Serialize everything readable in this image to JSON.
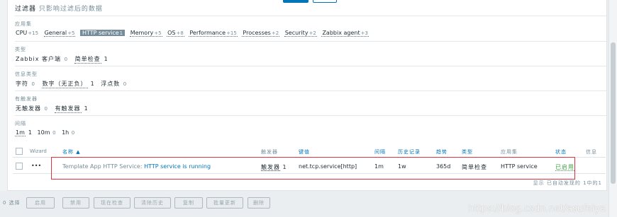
{
  "filter": {
    "title": "过滤器",
    "hint": "只影响过滤后的数据",
    "groups": {
      "app_sets": {
        "label": "应用集",
        "items": [
          {
            "name": "CPU",
            "count": "+15"
          },
          {
            "name": "General",
            "count": "+5"
          },
          {
            "name": "HTTP service",
            "count": "1"
          },
          {
            "name": "Memory",
            "count": "+5"
          },
          {
            "name": "OS",
            "count": "+8"
          },
          {
            "name": "Performance",
            "count": "+15"
          },
          {
            "name": "Processes",
            "count": "+2"
          },
          {
            "name": "Security",
            "count": "+2"
          },
          {
            "name": "Zabbix agent",
            "count": "+3"
          }
        ]
      },
      "type": {
        "label": "类型",
        "items": [
          {
            "name": "Zabbix 客户端",
            "count": "0"
          },
          {
            "name": "简单检查",
            "count": "1"
          }
        ]
      },
      "info_type": {
        "label": "信息类型",
        "items": [
          {
            "name": "字符",
            "count": "0"
          },
          {
            "name": "数字（无正负）",
            "count": "1"
          },
          {
            "name": "浮点数",
            "count": "0"
          }
        ]
      },
      "triggers": {
        "label": "有触发器",
        "items": [
          {
            "name": "无触发器",
            "count": "0"
          },
          {
            "name": "有触发器",
            "count": "1"
          }
        ]
      },
      "interval": {
        "label": "间隔",
        "items": [
          {
            "name": "1m",
            "count": "1"
          },
          {
            "name": "10m",
            "count": "0"
          },
          {
            "name": "1h",
            "count": "0"
          }
        ]
      }
    }
  },
  "table": {
    "headers": {
      "wizard": "Wizard",
      "name": "名称 ▲",
      "triggers": "触发器",
      "key": "键值",
      "interval": "间隔",
      "history": "历史记录",
      "trends": "趋势",
      "type": "类型",
      "app": "应用集",
      "status": "状态",
      "info": "信息"
    },
    "row": {
      "wizard": "•••",
      "template": "Template App HTTP Service",
      "sep": ": ",
      "name": "HTTP service is running",
      "triggers": "触发器",
      "triggers_count": "1",
      "key": "net.tcp.service[http]",
      "interval": "1m",
      "history": "1w",
      "trends": "365d",
      "type": "简单检查",
      "app": "HTTP service",
      "status": "已启用"
    },
    "footer": "显示 已自动发现的 1中的1"
  },
  "actions": {
    "selected": "0 选择",
    "buttons": [
      "启用",
      "禁用",
      "现在检查",
      "清除历史",
      "复制",
      "批量更新",
      "删除"
    ]
  },
  "watermark": "https://blog.csdn.net/asufeiya",
  "colors": {
    "link": "#0275b8",
    "enabled": "#429e47",
    "highlight": "#e3313f"
  }
}
